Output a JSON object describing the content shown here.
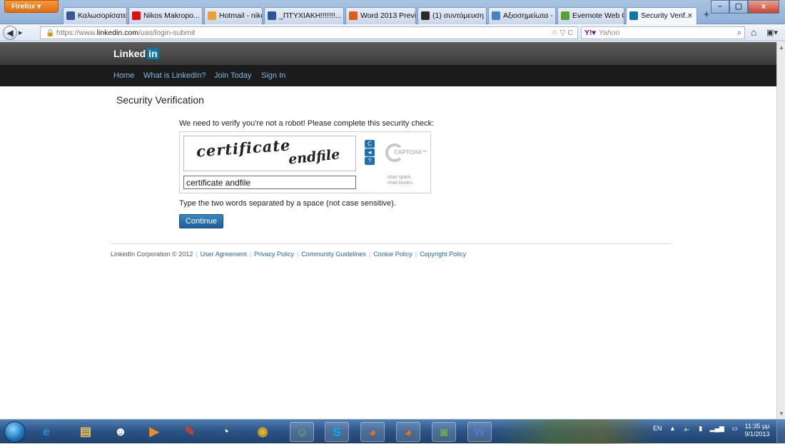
{
  "browser": {
    "app_button": "Firefox",
    "tabs": [
      {
        "label": "Καλωσορίσατε ...",
        "color": "#3b5998"
      },
      {
        "label": "Nikos Makropo...",
        "color": "#d11"
      },
      {
        "label": "Hotmail - nikolit...",
        "color": "#f0a030"
      },
      {
        "label": "_ΠΤΥΧΙΑΚΗ!!!!!!!...",
        "color": "#2b579a"
      },
      {
        "label": "Word 2013 Previ...",
        "color": "#e05a1c"
      },
      {
        "label": "(1) συντόμευση ...",
        "color": "#2a2a2a"
      },
      {
        "label": "Αξιοσημείωτα - ...",
        "color": "#4a80c0"
      },
      {
        "label": "Evernote Web Cl...",
        "color": "#5aa02c"
      },
      {
        "label": "Security Verif...",
        "color": "#0e76a8"
      }
    ],
    "tab_close": "×",
    "new_tab": "+",
    "url_prefix": "https://www.",
    "url_domain": "linkedin.com",
    "url_path": "/uas/login-submit",
    "url_controls": "☆ ▽ C",
    "search_engine": "Y!",
    "search_arrow": "▾",
    "search_placeholder": "Yahoo",
    "window_buttons": {
      "min": "–",
      "max": "▢",
      "close": "x"
    }
  },
  "linkedin": {
    "logo_word": "Linked",
    "logo_in": "in",
    "nav": [
      "Home",
      "What is LinkedIn?",
      "Join Today",
      "Sign In"
    ]
  },
  "page": {
    "title": "Security Verification",
    "instructions": "We need to verify you're not a robot! Please complete this security check:",
    "captcha": {
      "word1": "certificate",
      "word2": "endfile",
      "buttons": [
        "C",
        "◄",
        "?"
      ],
      "logo_text": "CAPTCHA™",
      "tagline_1": "stop spam.",
      "tagline_2": "read books.",
      "input_value": "certificate andfile"
    },
    "hint": "Type the two words separated by a space (not case sensitive).",
    "continue_label": "Continue"
  },
  "footer": {
    "copyright": "LinkedIn Corporation © 2012",
    "links": [
      "User Agreement",
      "Privacy Policy",
      "Community Guidelines",
      "Cookie Policy",
      "Copyright Policy"
    ]
  },
  "taskbar": {
    "language": "EN",
    "time": "11:35 μμ",
    "date": "9/1/2013",
    "icons": [
      {
        "name": "ie-icon",
        "glyph": "e",
        "color": "#2a8de0"
      },
      {
        "name": "explorer-icon",
        "glyph": "▤",
        "color": "#f2c35a"
      },
      {
        "name": "people-icon",
        "glyph": "☻",
        "color": "#fff"
      },
      {
        "name": "media-player-icon",
        "glyph": "▶",
        "color": "#f28c1e"
      },
      {
        "name": "pin-icon",
        "glyph": "✎",
        "color": "#e03a2a"
      },
      {
        "name": "clock-icon",
        "glyph": "◔",
        "color": "#fff"
      },
      {
        "name": "chrome-icon",
        "glyph": "◉",
        "color": "#e8b320"
      },
      {
        "name": "messenger-icon",
        "glyph": "☺",
        "color": "#7bc043"
      },
      {
        "name": "skype-icon",
        "glyph": "S",
        "color": "#00aff0"
      },
      {
        "name": "firefox-icon",
        "glyph": "◕",
        "color": "#e8731e"
      },
      {
        "name": "firefox-alt-icon",
        "glyph": "◕",
        "color": "#e8731e"
      },
      {
        "name": "evernote-icon",
        "glyph": "◙",
        "color": "#6ab04c"
      },
      {
        "name": "word-icon",
        "glyph": "W",
        "color": "#4a7fc8"
      }
    ]
  }
}
